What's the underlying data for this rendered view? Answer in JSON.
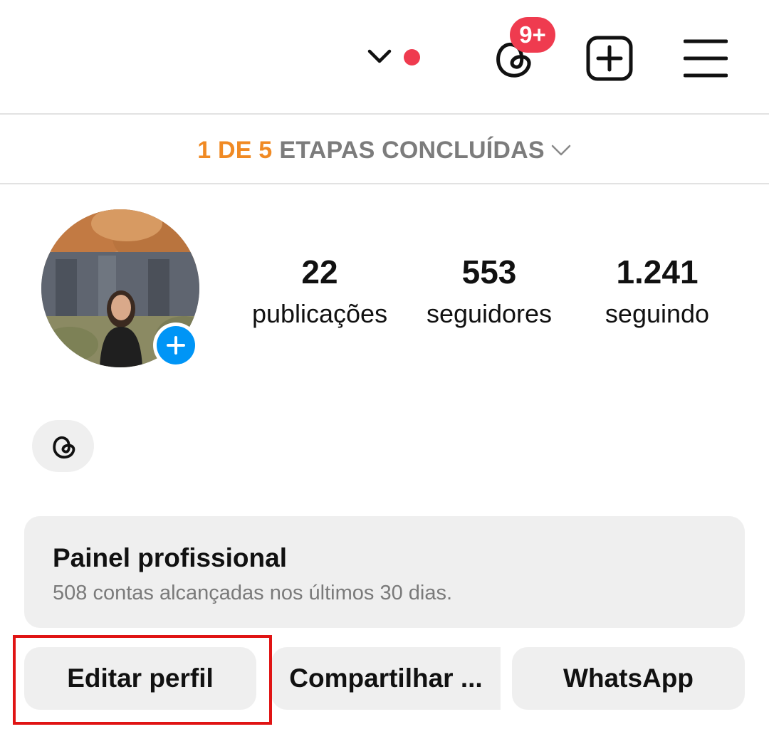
{
  "header": {
    "account_switch_icon": "chevron-down-icon",
    "notification_dot_color": "#ef3b4f",
    "threads_icon": "threads-icon",
    "threads_badge": "9+",
    "badge_color": "#ef3b4f",
    "new_post_icon": "plus-square-icon",
    "menu_icon": "hamburger-menu-icon"
  },
  "steps": {
    "done": "1 DE 5",
    "label": "ETAPAS CONCLUÍDAS",
    "done_color": "#f08a24",
    "chevron_icon": "chevron-down-icon"
  },
  "profile": {
    "avatar_icon": "avatar-photo",
    "add_story_icon": "plus-icon",
    "add_story_color": "#0095f6",
    "stats": [
      {
        "value": "22",
        "label": "publicações"
      },
      {
        "value": "553",
        "label": "seguidores"
      },
      {
        "value": "1.241",
        "label": "seguindo"
      }
    ],
    "threads_chip_icon": "threads-icon"
  },
  "panel": {
    "title": "Painel profissional",
    "subtitle": "508 contas alcançadas nos últimos 30 dias."
  },
  "buttons": {
    "edit": "Editar perfil",
    "share": "Compartilhar ...",
    "whatsapp": "WhatsApp"
  },
  "highlight_color": "#e01414"
}
